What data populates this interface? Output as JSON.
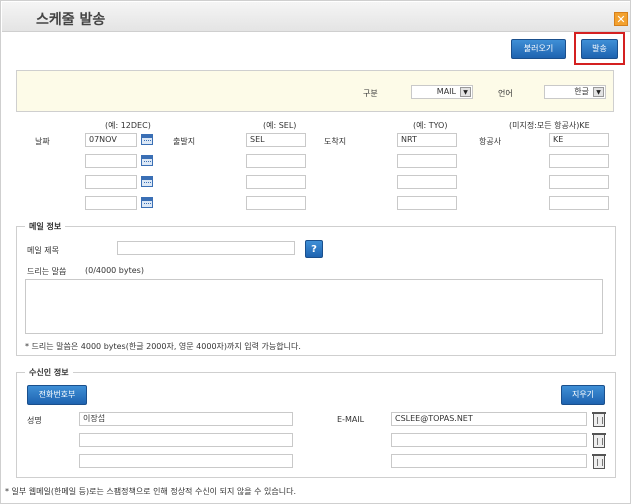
{
  "window": {
    "title": "스케줄 발송",
    "close_icon": "close-icon"
  },
  "toolbar": {
    "load_label": "불러오기",
    "send_label": "발송"
  },
  "options": {
    "type_label": "구분",
    "type_value": "MAIL",
    "lang_label": "언어",
    "lang_value": "한글"
  },
  "schedule": {
    "hint_date": "(예: 12DEC)",
    "hint_from": "(예: SEL)",
    "hint_to": "(예: TYO)",
    "hint_airline": "(미지정:모든 항공사)KE",
    "label_date": "날짜",
    "label_from": "출발지",
    "label_to": "도착지",
    "label_airline": "항공사",
    "rows": [
      {
        "date": "07NOV",
        "from": "SEL",
        "to": "NRT",
        "airline": "KE"
      },
      {
        "date": "",
        "from": "",
        "to": "",
        "airline": ""
      },
      {
        "date": "",
        "from": "",
        "to": "",
        "airline": ""
      },
      {
        "date": "",
        "from": "",
        "to": "",
        "airline": ""
      }
    ]
  },
  "mail": {
    "legend": "메일 정보",
    "subject_label": "메일 제목",
    "subject_value": "",
    "help_label": "?",
    "message_label": "드리는 말씀",
    "message_count": "(0/4000 bytes)",
    "note": "* 드리는 말씀은 4000 bytes(한글 2000자, 영문 4000자)까지 입력 가능합니다."
  },
  "recipient": {
    "legend": "수신인 정보",
    "phonebook_label": "전화번호부",
    "clear_label": "지우기",
    "name_label": "성명",
    "email_label": "E-MAIL",
    "rows": [
      {
        "name": "이장섭",
        "email": "CSLEE@TOPAS.NET"
      },
      {
        "name": "",
        "email": ""
      },
      {
        "name": "",
        "email": ""
      }
    ]
  },
  "footer_note": "* 일부 웹메일(한메일 등)로는 스팸정책으로 인해 정상적 수신이 되지 않을 수 있습니다."
}
